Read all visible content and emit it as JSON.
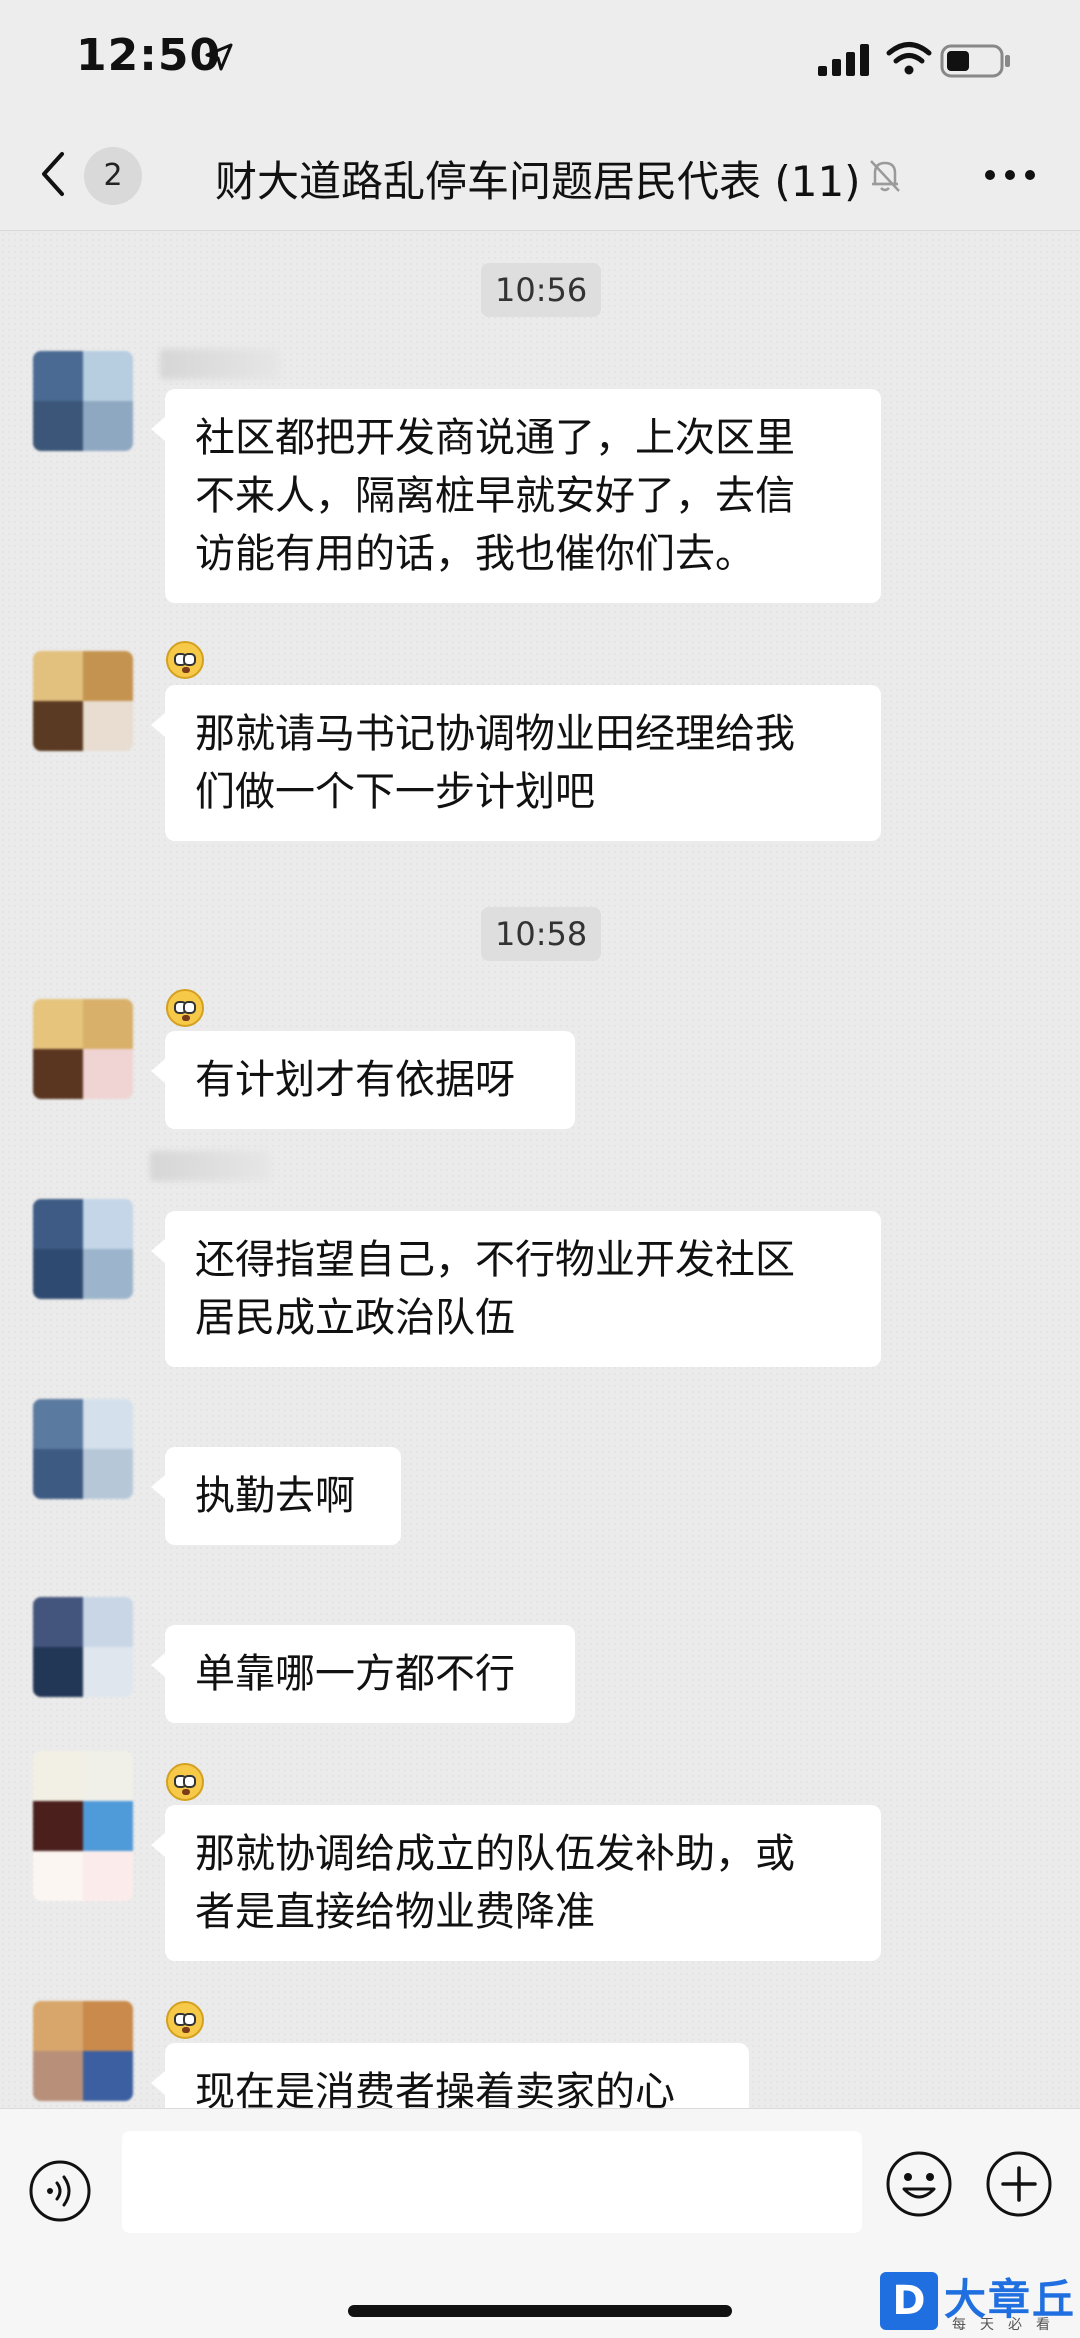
{
  "status_bar": {
    "time": "12:50",
    "icons": [
      "location-arrow-icon",
      "cellular-signal-icon",
      "wifi-icon",
      "battery-icon"
    ]
  },
  "nav": {
    "unread_count": "2",
    "title": "财大道路乱停车问题居民代表 (11)",
    "icons": [
      "back-chevron-icon",
      "mute-bell-icon",
      "more-dots-icon"
    ]
  },
  "chat": {
    "timestamps": [
      "10:56",
      "10:58"
    ],
    "messages": [
      {
        "text_lines": [
          "社区都把开发商说通了，上次区里",
          "不来人，隔离桩早就安好了，去信",
          "访能有用的话，我也催你们去。"
        ]
      },
      {
        "text_lines": [
          "那就请马书记协调物业田经理给我",
          "们做一个下一步计划吧"
        ]
      },
      {
        "text_lines": [
          "有计划才有依据呀"
        ]
      },
      {
        "text_lines": [
          "还得指望自己，不行物业开发社区",
          "居民成立政治队伍"
        ]
      },
      {
        "text_lines": [
          "执勤去啊"
        ]
      },
      {
        "text_lines": [
          "单靠哪一方都不行"
        ]
      },
      {
        "text_lines": [
          "那就协调给成立的队伍发补助，或",
          "者是直接给物业费降准"
        ]
      },
      {
        "text_lines": [
          "现在是消费者操着卖家的心"
        ]
      }
    ]
  },
  "input_bar": {
    "icons": [
      "voice-icon",
      "emoji-icon",
      "plus-icon"
    ],
    "placeholder": ""
  },
  "watermark": {
    "logo_letter": "D",
    "name": "大章丘",
    "tagline": "每天必看"
  },
  "colors": {
    "background": "#ededed",
    "bubble": "#ffffff",
    "watermark_blue": "#1f6fe0"
  }
}
